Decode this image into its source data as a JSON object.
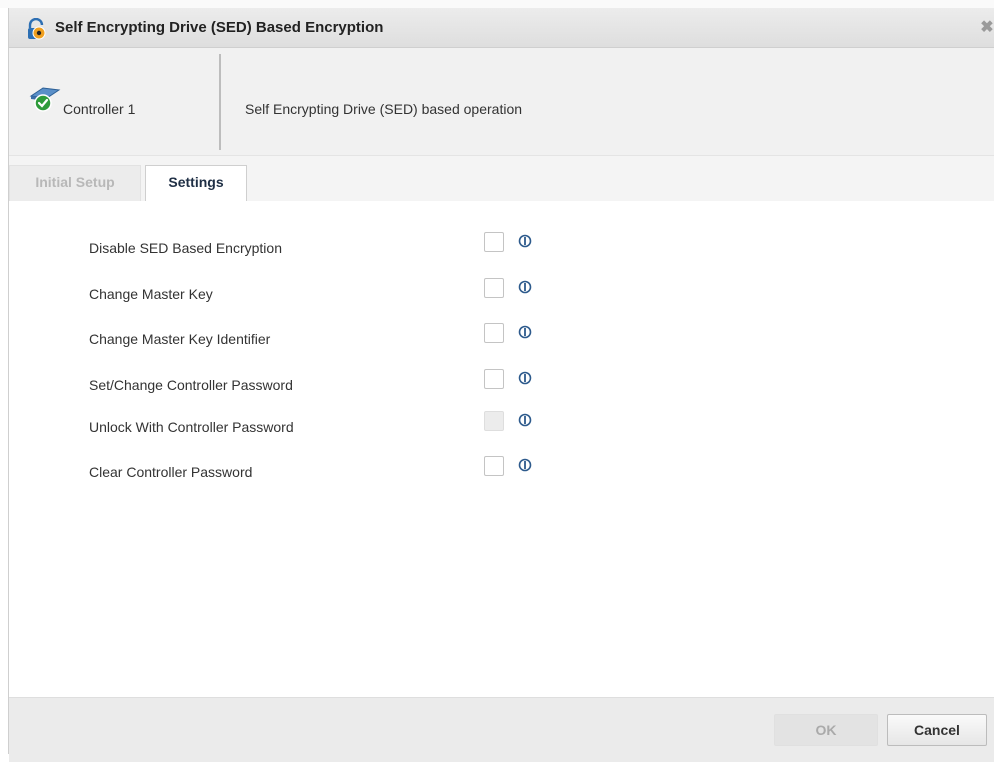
{
  "dialog": {
    "title": "Self Encrypting Drive (SED) Based Encryption",
    "close_symbol": "✖"
  },
  "controller": {
    "name": "Controller 1",
    "description": "Self Encrypting Drive (SED) based operation",
    "icon": "controller-ok-icon"
  },
  "tabs": [
    {
      "label": "Initial Setup",
      "active": false,
      "disabled": true
    },
    {
      "label": "Settings",
      "active": true,
      "disabled": false
    }
  ],
  "options": [
    {
      "label": "Disable SED Based Encryption",
      "checked": false,
      "disabled": false
    },
    {
      "label": "Change Master Key",
      "checked": false,
      "disabled": false
    },
    {
      "label": "Change Master Key Identifier",
      "checked": false,
      "disabled": false
    },
    {
      "label": "Set/Change Controller Password",
      "checked": false,
      "disabled": false
    },
    {
      "label": "Unlock With Controller Password",
      "checked": false,
      "disabled": true
    },
    {
      "label": "Clear Controller Password",
      "checked": false,
      "disabled": false
    }
  ],
  "buttons": {
    "ok": "OK",
    "cancel": "Cancel",
    "ok_disabled": true
  },
  "colors": {
    "accent_dark": "#1f2f45",
    "titlebar": "#e4e4e4",
    "footer": "#ebebeb"
  }
}
